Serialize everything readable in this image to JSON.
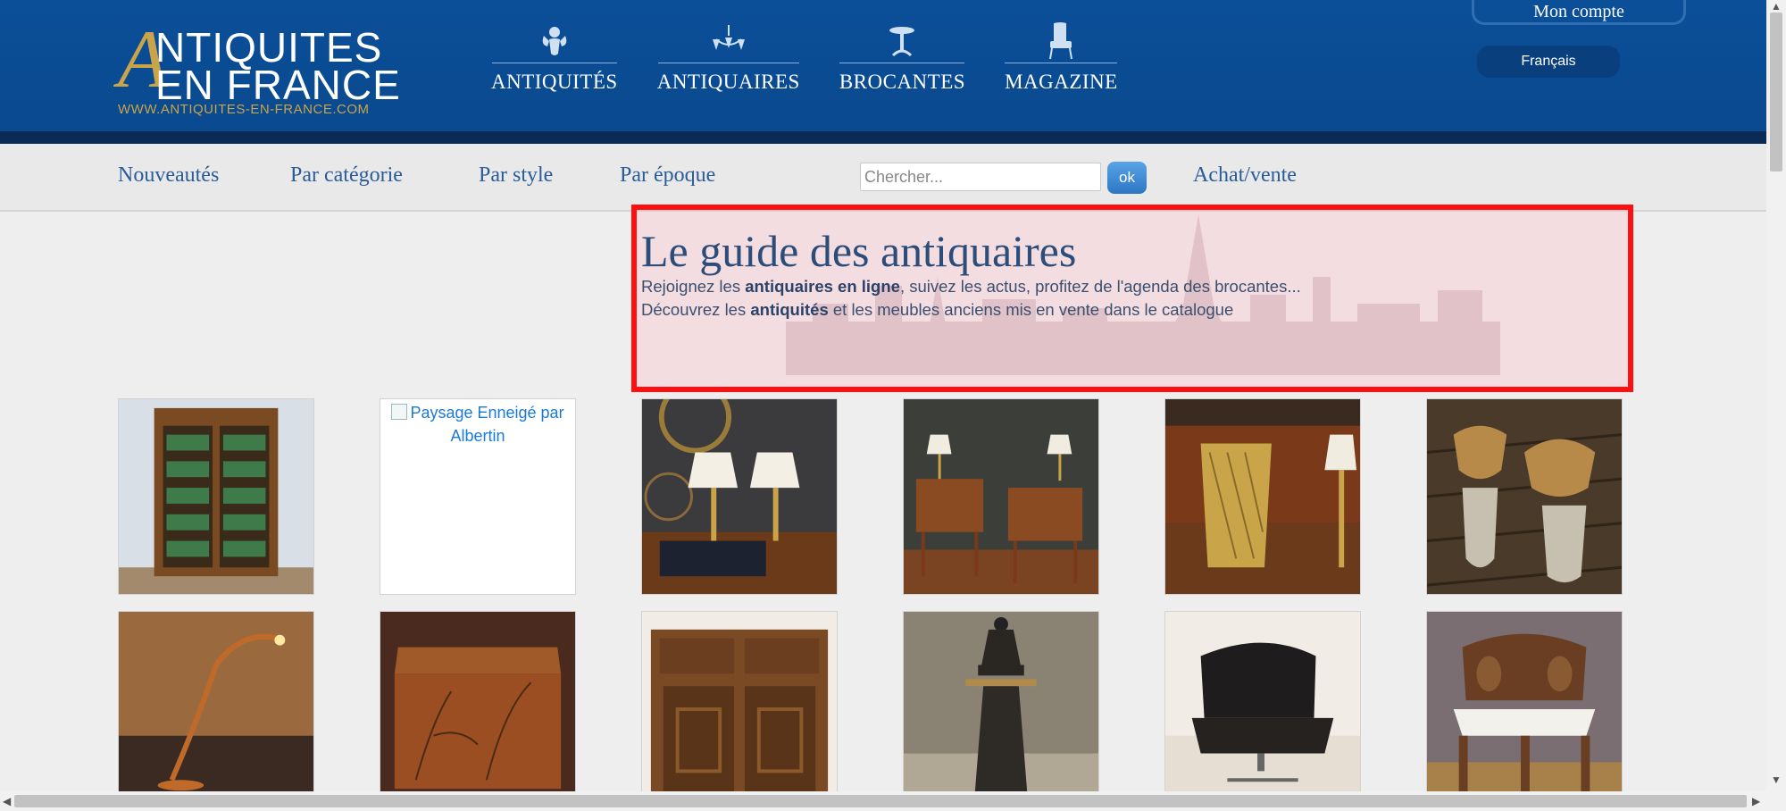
{
  "header": {
    "logo": {
      "initial": "A",
      "line1": "NTIQUITES",
      "line2": "EN FRANCE",
      "url": "WWW.ANTIQUITES-EN-FRANCE.COM"
    },
    "nav": [
      {
        "label": "ANTIQUITÉS",
        "icon": "cherub-icon"
      },
      {
        "label": "ANTIQUAIRES",
        "icon": "chandelier-icon"
      },
      {
        "label": "BROCANTES",
        "icon": "pedestal-table-icon"
      },
      {
        "label": "MAGAZINE",
        "icon": "armchair-icon"
      }
    ],
    "account_label": "Mon compte",
    "language_label": "Français"
  },
  "subnav": {
    "links": [
      "Nouveautés",
      "Par catégorie",
      "Par style",
      "Par époque"
    ],
    "search_placeholder": "Chercher...",
    "search_button": "ok",
    "achat_vente": "Achat/vente"
  },
  "intro": {
    "title": "Le guide des antiquaires",
    "line1_pre": "Rejoignez les ",
    "line1_bold": "antiquaires en ligne",
    "line1_post": ", suivez les actus, profitez de l'agenda des brocantes...",
    "line2_pre": "Découvrez les ",
    "line2_bold": "antiquités",
    "line2_post": " et les meubles anciens mis en vente dans le catalogue"
  },
  "products": {
    "row1": [
      {
        "kind": "bookcase"
      },
      {
        "kind": "broken",
        "alt": "Paysage Enneigé par Albertin"
      },
      {
        "kind": "lamps-desk"
      },
      {
        "kind": "nightstands"
      },
      {
        "kind": "brass-basket"
      },
      {
        "kind": "corbels"
      }
    ],
    "row2": [
      {
        "kind": "floor-lamp"
      },
      {
        "kind": "chest"
      },
      {
        "kind": "cabinet"
      },
      {
        "kind": "fountain"
      },
      {
        "kind": "lounge-chair"
      },
      {
        "kind": "corner-chair"
      }
    ]
  },
  "colors": {
    "header_blue": "#0b4f99",
    "gold": "#c9a44a",
    "link_blue": "#2a5c99",
    "highlight_red": "#ff1010"
  }
}
